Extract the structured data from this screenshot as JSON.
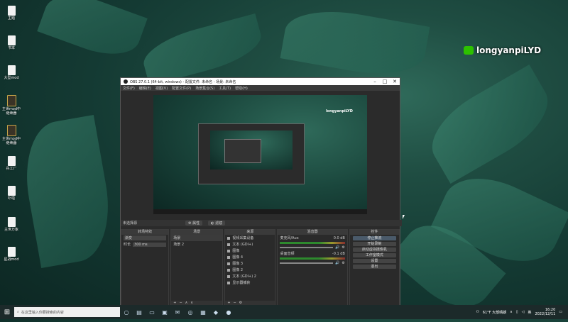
{
  "desktop": {
    "icons": [
      {
        "label": "主题"
      },
      {
        "label": "书本"
      },
      {
        "label": "大型mod"
      },
      {
        "label": "主世mod中\n继续器"
      },
      {
        "label": "主世mod中\n继续器"
      },
      {
        "label": "兵工厂"
      },
      {
        "label": "卟啦"
      },
      {
        "label": "主世万象"
      },
      {
        "label": "星战mod"
      }
    ],
    "watermark": "longyanpiLYD"
  },
  "obs": {
    "title": "OBS 27.0.1 (64-bit, windows) - 配置文件: 未命名 - 场景: 未命名",
    "menu": [
      "文件(F)",
      "编辑(E)",
      "视图(V)",
      "配置文件(P)",
      "场景集合(S)",
      "工具(T)",
      "帮助(H)"
    ],
    "preview_watermark": "longyanpiLYD",
    "source_bar": {
      "label": "未选择源",
      "properties": "属性",
      "filters": "滤镜"
    },
    "docks": {
      "scene_transitions": {
        "title": "转场特效",
        "transition": "渐变",
        "duration_label": "时长",
        "duration": "300 ms"
      },
      "scenes": {
        "title": "场景",
        "items": [
          "场景",
          "场景 2"
        ]
      },
      "sources": {
        "title": "来源",
        "items": [
          "视频采集设备",
          "文本 (GDI+)",
          "图像",
          "图像 4",
          "图像 3",
          "图像 2",
          "文本 (GDI+) 2",
          "显示器捕获"
        ]
      },
      "mixer": {
        "title": "混音器",
        "tracks": [
          {
            "name": "麦克风/Aux",
            "db": "0.0 dB"
          },
          {
            "name": "桌面音频",
            "db": "-0.1 dB"
          }
        ]
      },
      "controls": {
        "title": "控件",
        "buttons": [
          "停止推流",
          "开始录制",
          "启动虚拟摄像机",
          "工作室模式",
          "设置",
          "退出"
        ]
      }
    }
  },
  "taskbar": {
    "search_placeholder": "在这里输入你要搜索的内容",
    "weather": "61°F 大部晴朗",
    "lang": "英",
    "time": "16:20",
    "date": "2022/12/11"
  }
}
